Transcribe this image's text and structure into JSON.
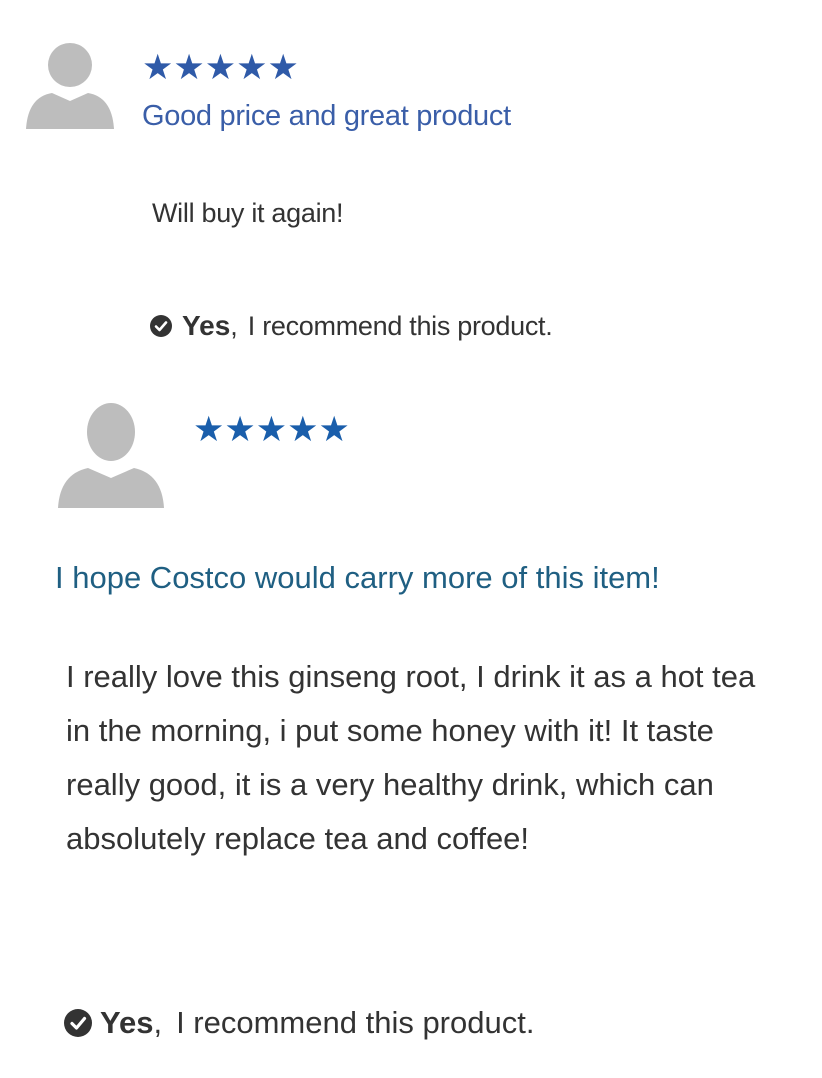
{
  "reviews": [
    {
      "rating_stars": "★★★★★",
      "title": "Good price and great product",
      "body": "Will buy it again!",
      "recommend_yes": "Yes",
      "recommend_rest": "I recommend this product."
    },
    {
      "rating_stars": "★★★★★",
      "title": "I hope Costco would carry more of this item!",
      "body": "I really love this ginseng root, I drink it as a hot tea in the morning, i put some honey with it! It taste really good, it is a very healthy drink, which can absolutely replace tea and coffee!",
      "recommend_yes": "Yes",
      "recommend_rest": "I recommend this product."
    }
  ],
  "icons": {
    "avatar": "user-avatar-icon",
    "check": "check-circle-icon"
  },
  "colors": {
    "avatar_gray": "#bdbdbd",
    "star_blue_1": "#2f5aa8",
    "star_blue_2": "#1a5eab",
    "title_blue_1": "#3a5ea8",
    "title_blue_2": "#1f5f82",
    "text_dark": "#333333"
  }
}
